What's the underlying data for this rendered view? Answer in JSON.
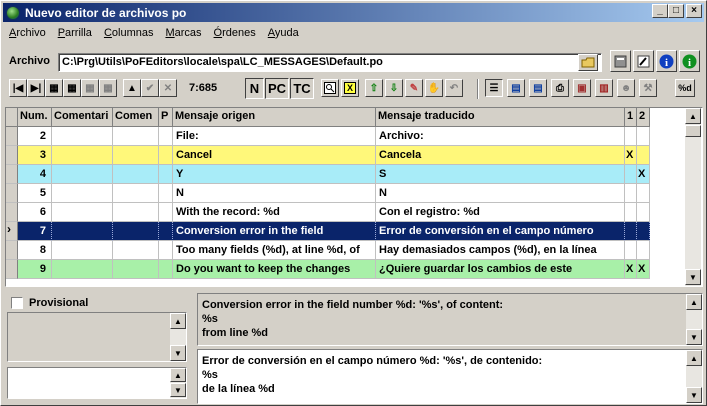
{
  "window": {
    "title": "Nuevo editor de archivos po"
  },
  "menu": [
    "Archivo",
    "Parrilla",
    "Columnas",
    "Marcas",
    "Órdenes",
    "Ayuda"
  ],
  "file": {
    "label": "Archivo",
    "path": "C:\\Prg\\Utils\\PoFEditors\\locale\\spa\\LC_MESSAGES\\Default.po"
  },
  "toolbar": {
    "position": "7:685",
    "btn_n": "N",
    "btn_pc": "PC",
    "btn_tc": "TC",
    "btn_x": "X",
    "btn_fmt": "%d"
  },
  "grid": {
    "columns": [
      "Num.",
      "Comentari",
      "Comen",
      "P",
      "Mensaje origen",
      "Mensaje traducido",
      "1",
      "2"
    ],
    "rows": [
      {
        "num": "2",
        "orig": "File:",
        "trad": "Archivo:",
        "c1": "",
        "c2": "",
        "bg": "#ffffff",
        "fg": "#000000"
      },
      {
        "num": "3",
        "orig": "Cancel",
        "trad": "Cancela",
        "c1": "X",
        "c2": "",
        "bg": "#fff87a",
        "fg": "#000000"
      },
      {
        "num": "4",
        "orig": "Y",
        "trad": "S",
        "c1": "",
        "c2": "X",
        "bg": "#a8ecf8",
        "fg": "#000000"
      },
      {
        "num": "5",
        "orig": "N",
        "trad": "N",
        "c1": "",
        "c2": "",
        "bg": "#ffffff",
        "fg": "#000000"
      },
      {
        "num": "6",
        "orig": "With the record: %d",
        "trad": "Con el registro: %d",
        "c1": "",
        "c2": "",
        "bg": "#ffffff",
        "fg": "#000000"
      },
      {
        "num": "7",
        "orig": "Conversion error in the field",
        "trad": "Error de conversión en el campo número",
        "c1": "",
        "c2": "",
        "bg": "#0a246a",
        "fg": "#ffffff"
      },
      {
        "num": "8",
        "orig": "Too many fields (%d), at line %d, of",
        "trad": "Hay demasiados campos (%d), en la línea",
        "c1": "",
        "c2": "",
        "bg": "#ffffff",
        "fg": "#000000"
      },
      {
        "num": "9",
        "orig": "Do you want to keep the changes",
        "trad": "¿Quiere guardar los cambios de este",
        "c1": "X",
        "c2": "X",
        "bg": "#a8f0a8",
        "fg": "#000000"
      }
    ]
  },
  "bottom": {
    "provisional_label": "Provisional",
    "source_text": "Conversion error in the field number %d: '%s', of content:\n%s\nfrom line %d",
    "translation_text": "Error de conversión en el campo número %d: '%s', de contenido:\n%s\nde la línea %d"
  }
}
